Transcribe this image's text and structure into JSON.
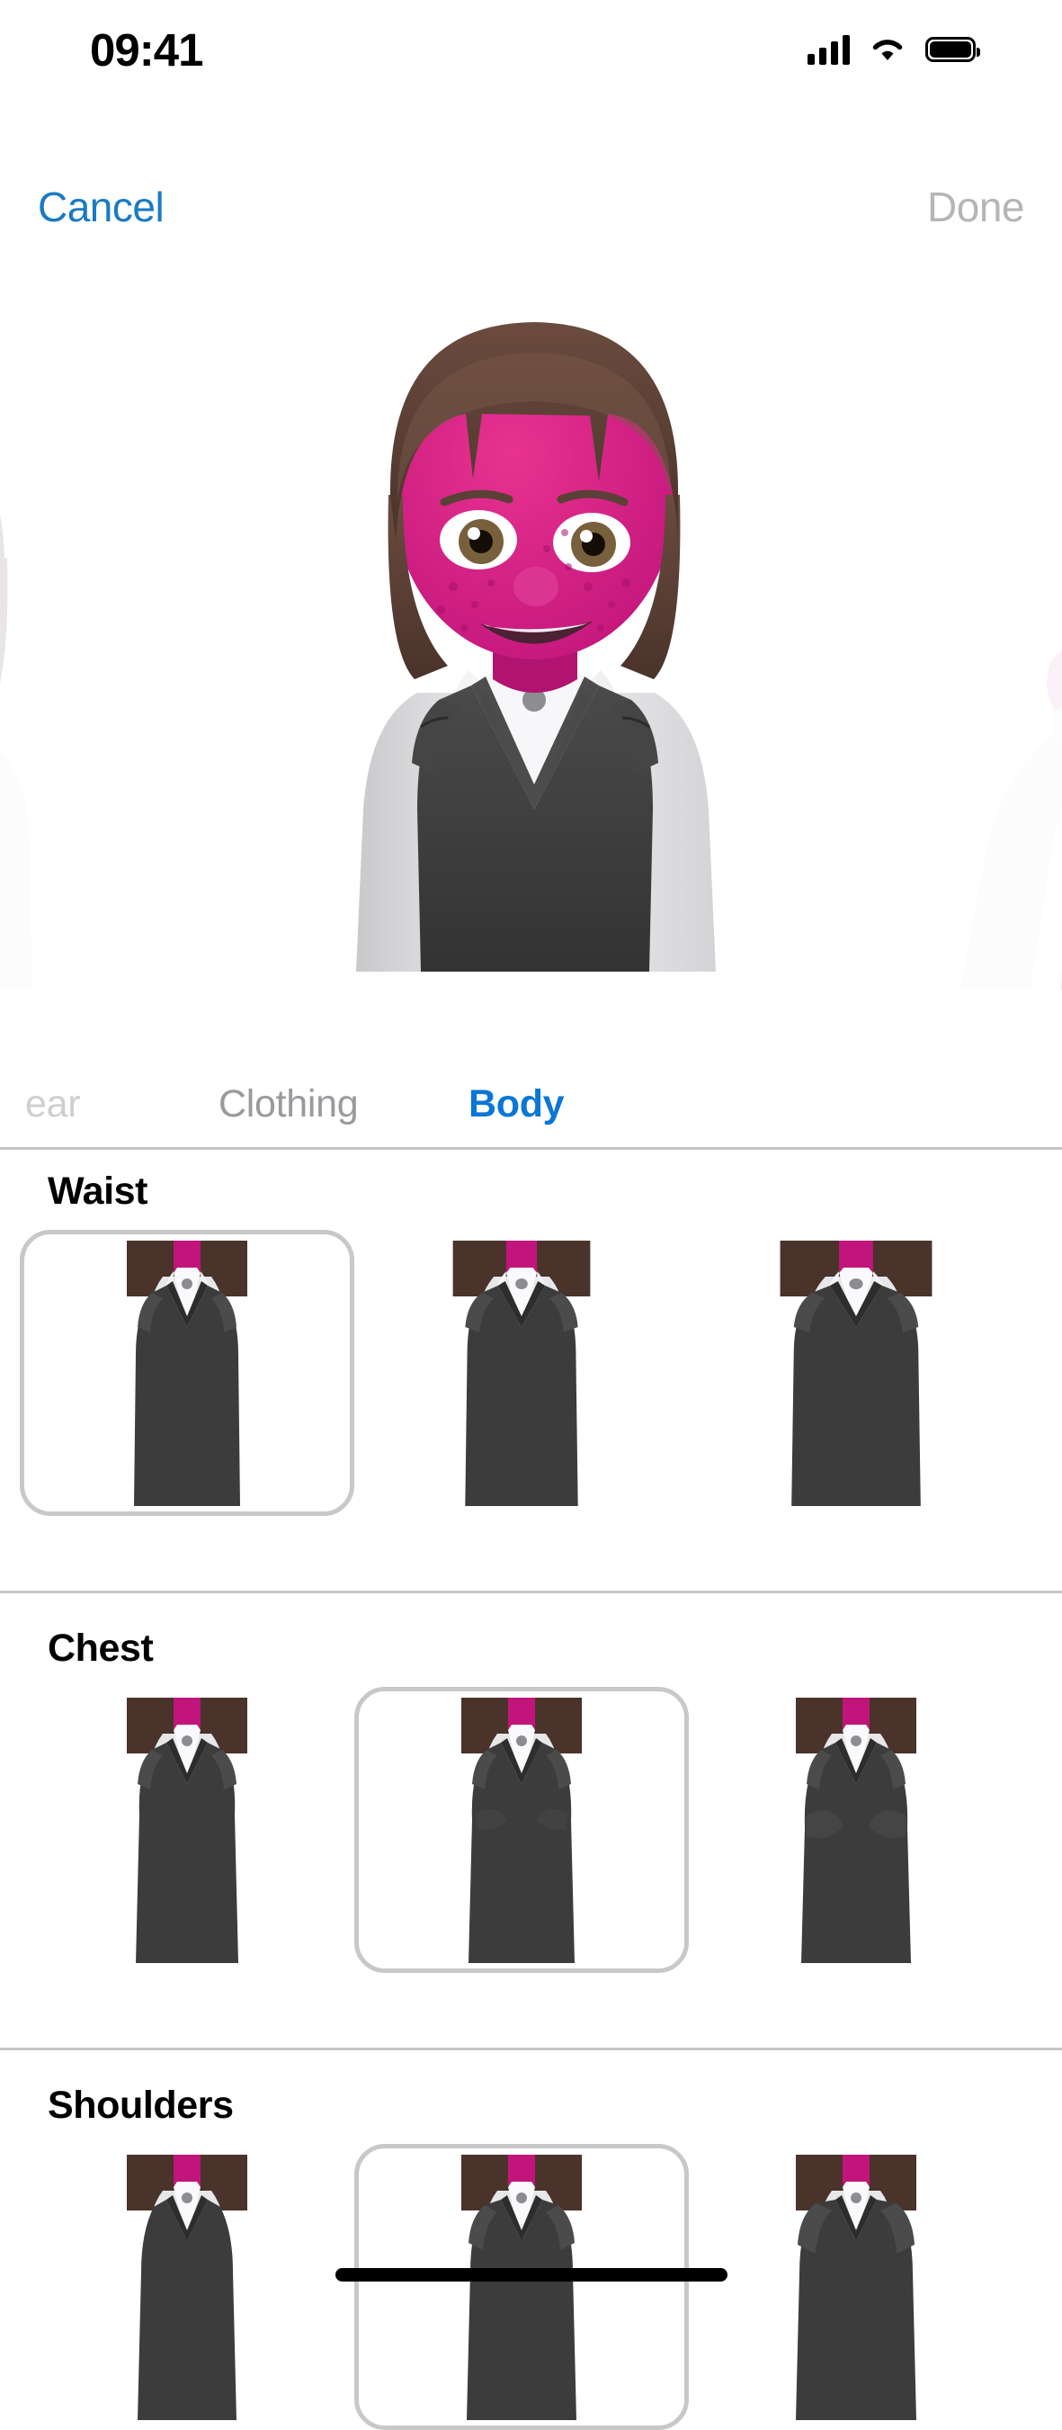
{
  "status_bar": {
    "time": "09:41",
    "cellular_icon": "signal-bars-icon",
    "wifi_icon": "wifi-icon",
    "battery_icon": "battery-icon"
  },
  "nav_bar": {
    "cancel_label": "Cancel",
    "done_label": "Done",
    "done_enabled": false
  },
  "avatar_preview": {
    "center_avatar_name": "memoji-current",
    "left_avatar_name": "memoji-previous",
    "right_avatar_name": "memoji-next",
    "skin_color": "#d81b8c",
    "hair_color": "#5e4238",
    "vest_color": "#3c3c3c",
    "shirt_color": "#e9e9ec"
  },
  "tabs": [
    {
      "label": "ear",
      "state": "cut-off"
    },
    {
      "label": "Clothing",
      "state": "inactive"
    },
    {
      "label": "Body",
      "state": "active"
    }
  ],
  "sections": [
    {
      "title": "Waist",
      "options": [
        {
          "label": "Waist option 1",
          "selected": true,
          "width": 1.0
        },
        {
          "label": "Waist option 2",
          "selected": false,
          "width": 1.14
        },
        {
          "label": "Waist option 3",
          "selected": false,
          "width": 1.26
        }
      ]
    },
    {
      "title": "Chest",
      "options": [
        {
          "label": "Chest option 1",
          "selected": false,
          "width": 1.0
        },
        {
          "label": "Chest option 2",
          "selected": true,
          "width": 1.08
        },
        {
          "label": "Chest option 3",
          "selected": false,
          "width": 1.18
        }
      ]
    },
    {
      "title": "Shoulders",
      "options": [
        {
          "label": "Shoulders option 1",
          "selected": false,
          "width": 1.0
        },
        {
          "label": "Shoulders option 2",
          "selected": true,
          "width": 1.1
        },
        {
          "label": "Shoulders option 3",
          "selected": false,
          "width": 1.2
        }
      ]
    }
  ],
  "colors": {
    "accent_blue": "#0b76d6",
    "cancel_blue": "#1a7ac4",
    "disabled_gray": "#b5b5b8",
    "separator_gray": "#c6c6c8",
    "selection_ring": "#c8c8cb"
  },
  "home_indicator": {
    "name": "home-indicator"
  }
}
